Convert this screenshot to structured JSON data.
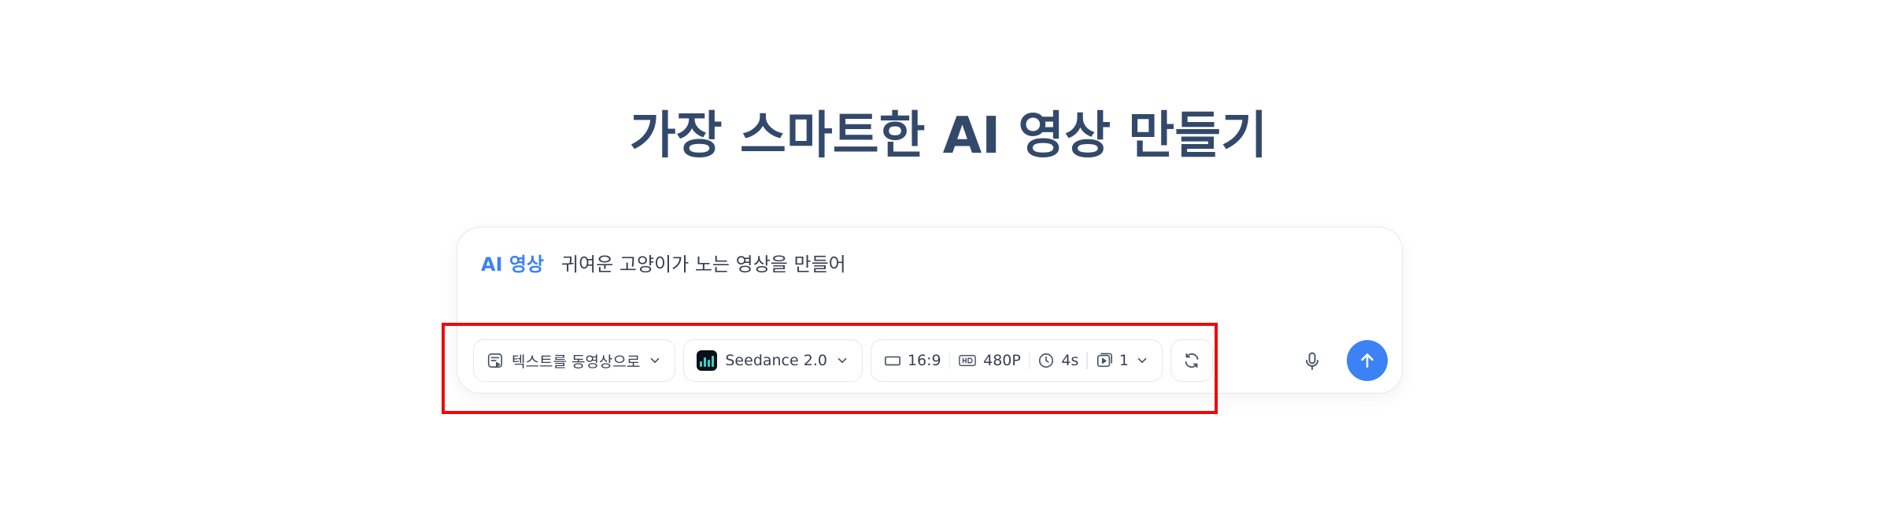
{
  "page": {
    "title": "가장 스마트한 AI 영상 만들기"
  },
  "composer": {
    "mode_tag": "AI 영상",
    "prompt_text": "귀여운 고양이가 노는 영상을 만들어"
  },
  "toolbar": {
    "mode_select": {
      "label": "텍스트를 동영상으로",
      "icon": "text-to-video-icon"
    },
    "model_select": {
      "label": "Seedance 2.0",
      "icon": "seedance-logo-icon"
    },
    "settings": {
      "aspect_ratio": "16:9",
      "resolution": "480P",
      "duration": "4s",
      "count": "1"
    },
    "refresh_icon": "refresh-icon"
  },
  "actions": {
    "mic_icon": "microphone-icon",
    "send_icon": "arrow-up-icon"
  },
  "colors": {
    "accent": "#3b82f6",
    "title": "#33496b",
    "highlight": "#ee0a0a"
  }
}
